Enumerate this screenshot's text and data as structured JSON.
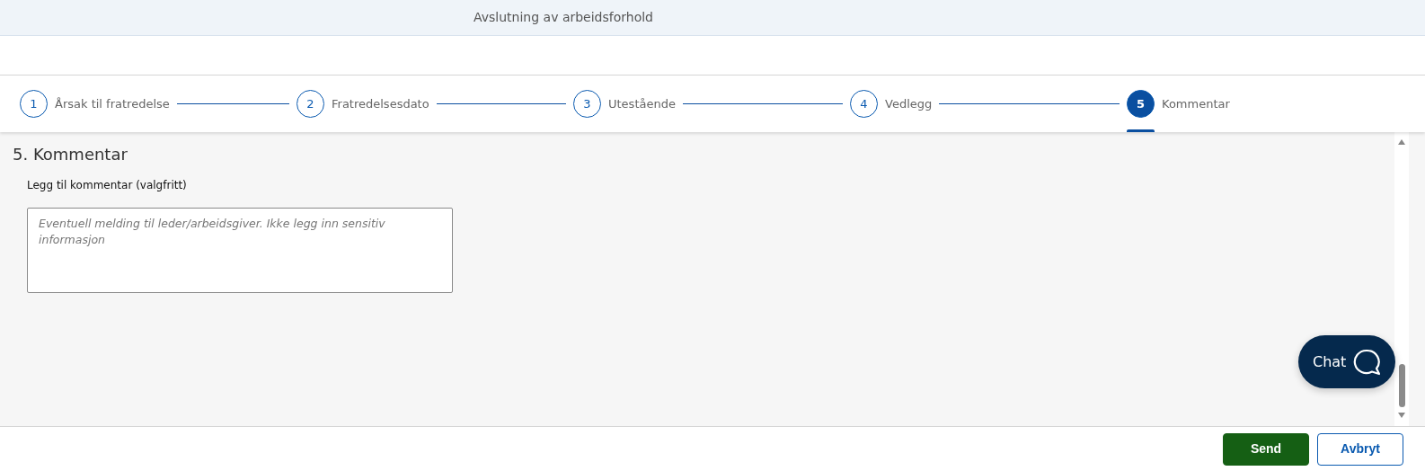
{
  "header": {
    "title": "Avslutning av arbeidsforhold"
  },
  "steps": [
    {
      "number": "1",
      "label": "Årsak til fratredelse",
      "selected": false
    },
    {
      "number": "2",
      "label": "Fratredelsesdato",
      "selected": false
    },
    {
      "number": "3",
      "label": "Utestående",
      "selected": false
    },
    {
      "number": "4",
      "label": "Vedlegg",
      "selected": false
    },
    {
      "number": "5",
      "label": "Kommentar",
      "selected": true
    }
  ],
  "section": {
    "heading": "5. Kommentar",
    "field_label": "Legg til kommentar (valgfritt)",
    "placeholder": "Eventuell melding til leder/arbeidsgiver. Ikke legg inn sensitiv informasjon"
  },
  "chat": {
    "label": "Chat"
  },
  "buttons": [
    {
      "label": "Send",
      "kind": "primary"
    },
    {
      "label": "Avbryt",
      "kind": "secondary"
    }
  ]
}
